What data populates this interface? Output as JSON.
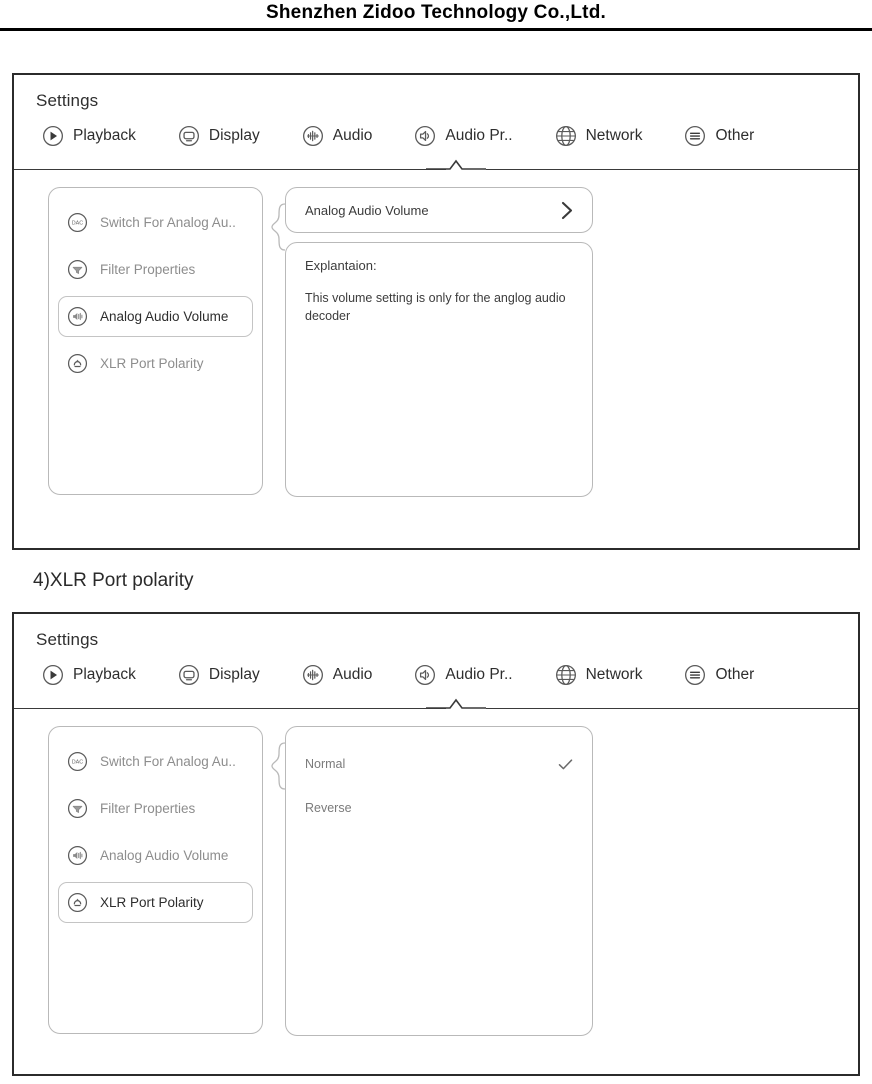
{
  "document": {
    "header_title": "Shenzhen Zidoo Technology Co.,Ltd.",
    "section_caption": "4)XLR Port polarity"
  },
  "colors": {
    "frame_border": "#2b2b2b",
    "card_border": "#b9b9b9",
    "text_primary": "#2d2d2d",
    "text_muted": "#8d8d8d"
  },
  "panel_one": {
    "title": "Settings",
    "tabs": [
      {
        "label": "Playback",
        "icon": "play-circle-icon",
        "active": false
      },
      {
        "label": "Display",
        "icon": "monitor-circle-icon",
        "active": false
      },
      {
        "label": "Audio",
        "icon": "equalizer-circle-icon",
        "active": false
      },
      {
        "label": "Audio Pr..",
        "icon": "speaker-circle-icon",
        "active": true
      },
      {
        "label": "Network",
        "icon": "globe-icon",
        "active": false
      },
      {
        "label": "Other",
        "icon": "list-circle-icon",
        "active": false
      }
    ],
    "sidebar": [
      {
        "label": "Switch For Analog Au..",
        "icon": "dac-circle-icon",
        "selected": false
      },
      {
        "label": "Filter Properties",
        "icon": "filter-circle-icon",
        "selected": false
      },
      {
        "label": "Analog Audio Volume",
        "icon": "volume-circle-icon",
        "selected": true
      },
      {
        "label": "XLR Port Polarity",
        "icon": "polarity-circle-icon",
        "selected": false
      }
    ],
    "detail": {
      "value_label": "Analog Audio Volume",
      "chevron_icon": "chevron-right-icon",
      "explanation_title": "Explantaion:",
      "explanation_text": "This volume setting is only for the anglog audio decoder"
    }
  },
  "panel_two": {
    "title": "Settings",
    "tabs": [
      {
        "label": "Playback",
        "icon": "play-circle-icon",
        "active": false
      },
      {
        "label": "Display",
        "icon": "monitor-circle-icon",
        "active": false
      },
      {
        "label": "Audio",
        "icon": "equalizer-circle-icon",
        "active": false
      },
      {
        "label": "Audio Pr..",
        "icon": "speaker-circle-icon",
        "active": true
      },
      {
        "label": "Network",
        "icon": "globe-icon",
        "active": false
      },
      {
        "label": "Other",
        "icon": "list-circle-icon",
        "active": false
      }
    ],
    "sidebar": [
      {
        "label": "Switch For Analog Au..",
        "icon": "dac-circle-icon",
        "selected": false
      },
      {
        "label": "Filter Properties",
        "icon": "filter-circle-icon",
        "selected": false
      },
      {
        "label": "Analog Audio Volume",
        "icon": "volume-circle-icon",
        "selected": false
      },
      {
        "label": "XLR Port Polarity",
        "icon": "polarity-circle-icon",
        "selected": true
      }
    ],
    "options": [
      {
        "label": "Normal",
        "checked": true
      },
      {
        "label": "Reverse",
        "checked": false
      }
    ]
  }
}
